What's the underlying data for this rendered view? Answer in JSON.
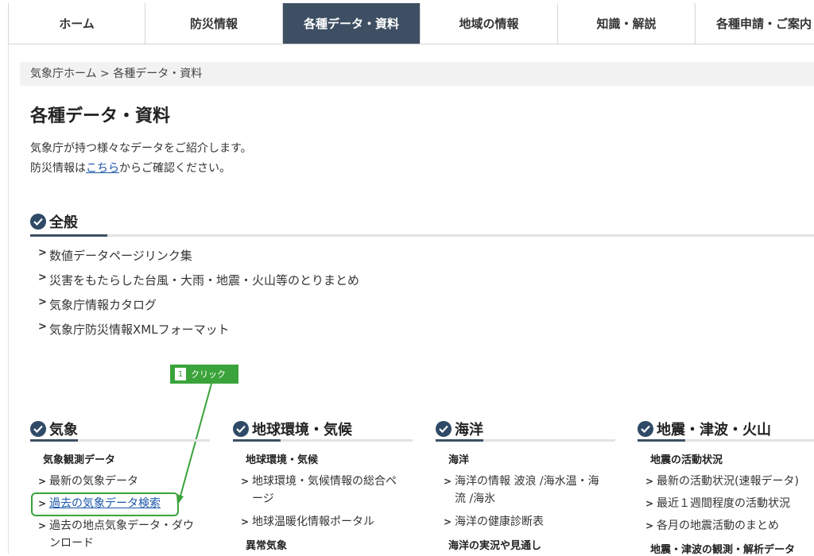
{
  "nav": [
    "ホーム",
    "防災情報",
    "各種データ・資料",
    "地域の情報",
    "知識・解説",
    "各種申請・ご案内"
  ],
  "breadcrumb": {
    "home": "気象庁ホーム",
    "sep": ">",
    "current": "各種データ・資料"
  },
  "page_title": "各種データ・資料",
  "intro": {
    "line1": "気象庁が持つ様々なデータをご紹介します。",
    "line2_pre": "防災情報は",
    "line2_link": "こちら",
    "line2_post": "からご確認ください。"
  },
  "general": {
    "title": "全般",
    "items": [
      "数値データページリンク集",
      "災害をもたらした台風・大雨・地震・火山等のとりまとめ",
      "気象庁情報カタログ",
      "気象庁防災情報XMLフォーマット"
    ]
  },
  "annotation": {
    "number": "1",
    "label": "クリック"
  },
  "weather": {
    "title": "気象",
    "sub1": "気象観測データ",
    "items": [
      "最新の気象データ",
      "過去の気象データ検索",
      "過去の地点気象データ・ダウ",
      "ンロード"
    ]
  },
  "climate": {
    "title": "地球環境・気候",
    "sub1": "地球環境・気候",
    "items": [
      "地球環境・気候情報の総合ペ",
      "ージ",
      "地球温暖化情報ポータル"
    ],
    "sub2": "異常気象"
  },
  "ocean": {
    "title": "海洋",
    "sub1": "海洋",
    "items": [
      "海洋の情報 波浪 /海水温・海",
      "流 /海氷",
      "海洋の健康診断表"
    ],
    "sub2": "海洋の実況や見通し"
  },
  "quake": {
    "title": "地震・津波・火山",
    "sub1": "地震の活動状況",
    "items": [
      "最新の活動状況(速報データ)",
      "最近１週間程度の活動状況",
      "各月の地震活動のまとめ"
    ],
    "sub2": "地震・津波の観測・解析データ"
  }
}
